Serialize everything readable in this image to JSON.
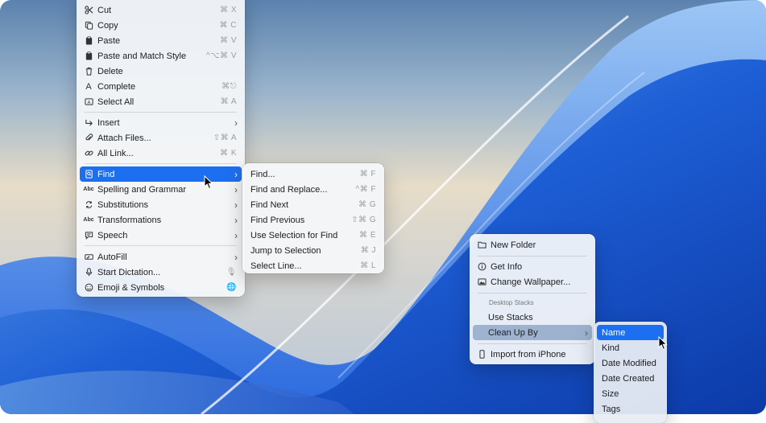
{
  "edit_menu": {
    "items": [
      {
        "label": "Cut",
        "shortcut": "⌘ X",
        "icon": "scissors-icon"
      },
      {
        "label": "Copy",
        "shortcut": "⌘ C",
        "icon": "copy-icon"
      },
      {
        "label": "Paste",
        "shortcut": "⌘ V",
        "icon": "clipboard-icon"
      },
      {
        "label": "Paste and Match Style",
        "shortcut": "^⌥⌘ V",
        "icon": "clipboard-icon"
      },
      {
        "label": "Delete",
        "shortcut": "",
        "icon": "trash-icon"
      },
      {
        "label": "Complete",
        "shortcut": "⌘⎋",
        "icon": "letter-a-icon"
      },
      {
        "label": "Select All",
        "shortcut": "⌘ A",
        "icon": "select-all-icon"
      },
      {
        "label": "Insert",
        "shortcut": "",
        "icon": "insert-arrow-icon"
      },
      {
        "label": "Attach Files...",
        "shortcut": "⇧⌘ A",
        "icon": "paperclip-icon"
      },
      {
        "label": "All Link...",
        "shortcut": "⌘ K",
        "icon": "link-icon"
      },
      {
        "label": "Find",
        "shortcut": "",
        "icon": "find-icon"
      },
      {
        "label": "Spelling and Grammar",
        "shortcut": "",
        "icon": "abc-check-icon"
      },
      {
        "label": "Substitutions",
        "shortcut": "",
        "icon": "substitution-icon"
      },
      {
        "label": "Transformations",
        "shortcut": "",
        "icon": "abc-icon"
      },
      {
        "label": "Speech",
        "shortcut": "",
        "icon": "speech-bubble-icon"
      },
      {
        "label": "AutoFill",
        "shortcut": "",
        "icon": "autofill-icon"
      },
      {
        "label": "Start Dictation...",
        "shortcut": "",
        "icon": "microphone-icon"
      },
      {
        "label": "Emoji & Symbols",
        "shortcut": "",
        "icon": "emoji-icon"
      }
    ]
  },
  "find_menu": {
    "items": [
      {
        "label": "Find...",
        "shortcut": "⌘ F"
      },
      {
        "label": "Find and Replace...",
        "shortcut": "^⌘ F"
      },
      {
        "label": "Find Next",
        "shortcut": "⌘ G"
      },
      {
        "label": "Find Previous",
        "shortcut": "⇧⌘ G"
      },
      {
        "label": "Use Selection for Find",
        "shortcut": "⌘ E"
      },
      {
        "label": "Jump to Selection",
        "shortcut": "⌘ J"
      },
      {
        "label": "Select Line...",
        "shortcut": "⌘ L"
      }
    ]
  },
  "desktop_menu": {
    "items": [
      {
        "label": "New Folder",
        "icon": "folder-icon"
      },
      {
        "label": "Get Info",
        "icon": "info-icon"
      },
      {
        "label": "Change Wallpaper...",
        "icon": "image-icon"
      },
      {
        "label": "Use Stacks"
      },
      {
        "label": "Clean Up By"
      },
      {
        "label": "Import from iPhone",
        "icon": "iphone-icon"
      }
    ],
    "section_header": "Desktop Stacks"
  },
  "cleanup_menu": {
    "items": [
      {
        "label": "Name"
      },
      {
        "label": "Kind"
      },
      {
        "label": "Date Modified"
      },
      {
        "label": "Date Created"
      },
      {
        "label": "Size"
      },
      {
        "label": "Tags"
      }
    ]
  },
  "colors": {
    "highlight": "#1d6ff1",
    "submenu_parent": "#6084b0",
    "wallpaper_blue": "#1f55c9"
  }
}
